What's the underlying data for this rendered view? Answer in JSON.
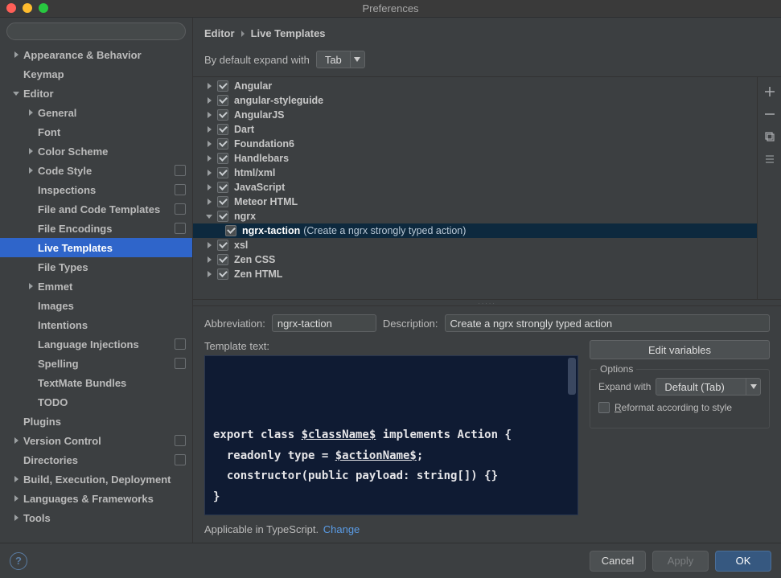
{
  "window": {
    "title": "Preferences"
  },
  "sidebar": {
    "search_placeholder": "",
    "items": [
      {
        "label": "Appearance & Behavior",
        "depth": 0,
        "arrow": "right",
        "bold": true
      },
      {
        "label": "Keymap",
        "depth": 0,
        "bold": true
      },
      {
        "label": "Editor",
        "depth": 0,
        "arrow": "down",
        "bold": true
      },
      {
        "label": "General",
        "depth": 1,
        "arrow": "right"
      },
      {
        "label": "Font",
        "depth": 1
      },
      {
        "label": "Color Scheme",
        "depth": 1,
        "arrow": "right"
      },
      {
        "label": "Code Style",
        "depth": 1,
        "arrow": "right",
        "badge": true
      },
      {
        "label": "Inspections",
        "depth": 1,
        "badge": true
      },
      {
        "label": "File and Code Templates",
        "depth": 1,
        "badge": true
      },
      {
        "label": "File Encodings",
        "depth": 1,
        "badge": true
      },
      {
        "label": "Live Templates",
        "depth": 1,
        "selected": true
      },
      {
        "label": "File Types",
        "depth": 1
      },
      {
        "label": "Emmet",
        "depth": 1,
        "arrow": "right"
      },
      {
        "label": "Images",
        "depth": 1
      },
      {
        "label": "Intentions",
        "depth": 1
      },
      {
        "label": "Language Injections",
        "depth": 1,
        "badge": true
      },
      {
        "label": "Spelling",
        "depth": 1,
        "badge": true
      },
      {
        "label": "TextMate Bundles",
        "depth": 1
      },
      {
        "label": "TODO",
        "depth": 1
      },
      {
        "label": "Plugins",
        "depth": 0,
        "bold": true
      },
      {
        "label": "Version Control",
        "depth": 0,
        "arrow": "right",
        "bold": true,
        "badge": true
      },
      {
        "label": "Directories",
        "depth": 0,
        "bold": true,
        "badge": true
      },
      {
        "label": "Build, Execution, Deployment",
        "depth": 0,
        "arrow": "right",
        "bold": true
      },
      {
        "label": "Languages & Frameworks",
        "depth": 0,
        "arrow": "right",
        "bold": true
      },
      {
        "label": "Tools",
        "depth": 0,
        "arrow": "right",
        "bold": true
      }
    ]
  },
  "breadcrumb": {
    "parent": "Editor",
    "current": "Live Templates"
  },
  "expand": {
    "label": "By default expand with",
    "value": "Tab"
  },
  "template_groups": [
    {
      "label": "Angular",
      "arrow": "right",
      "checked": true
    },
    {
      "label": "angular-styleguide",
      "arrow": "right",
      "checked": true
    },
    {
      "label": "AngularJS",
      "arrow": "right",
      "checked": true
    },
    {
      "label": "Dart",
      "arrow": "right",
      "checked": true
    },
    {
      "label": "Foundation6",
      "arrow": "right",
      "checked": true
    },
    {
      "label": "Handlebars",
      "arrow": "right",
      "checked": true
    },
    {
      "label": "html/xml",
      "arrow": "right",
      "checked": true
    },
    {
      "label": "JavaScript",
      "arrow": "right",
      "checked": true
    },
    {
      "label": "Meteor HTML",
      "arrow": "right",
      "checked": true
    },
    {
      "label": "ngrx",
      "arrow": "down",
      "checked": true,
      "children": [
        {
          "label": "ngrx-taction",
          "desc": "(Create a ngrx strongly typed action)",
          "checked": true,
          "selected": true
        }
      ]
    },
    {
      "label": "xsl",
      "arrow": "right",
      "checked": true
    },
    {
      "label": "Zen CSS",
      "arrow": "right",
      "checked": true
    },
    {
      "label": "Zen HTML",
      "arrow": "right",
      "checked": true
    }
  ],
  "detail": {
    "abbr_label": "Abbreviation:",
    "abbr_value": "ngrx-taction",
    "desc_label": "Description:",
    "desc_value": "Create a ngrx strongly typed action",
    "tmpl_label": "Template text:",
    "code_lines": [
      "export class $className$ implements Action {",
      "  readonly type = $actionName$;",
      "  constructor(public payload: string[]) {}",
      "}"
    ],
    "edit_vars": "Edit variables",
    "options_legend": "Options",
    "expand_with_label": "Expand with",
    "expand_with_value": "Default (Tab)",
    "reformat_label": "Reformat according to style",
    "applicable_text": "Applicable in TypeScript.",
    "change_label": "Change"
  },
  "footer": {
    "cancel": "Cancel",
    "apply": "Apply",
    "ok": "OK"
  }
}
